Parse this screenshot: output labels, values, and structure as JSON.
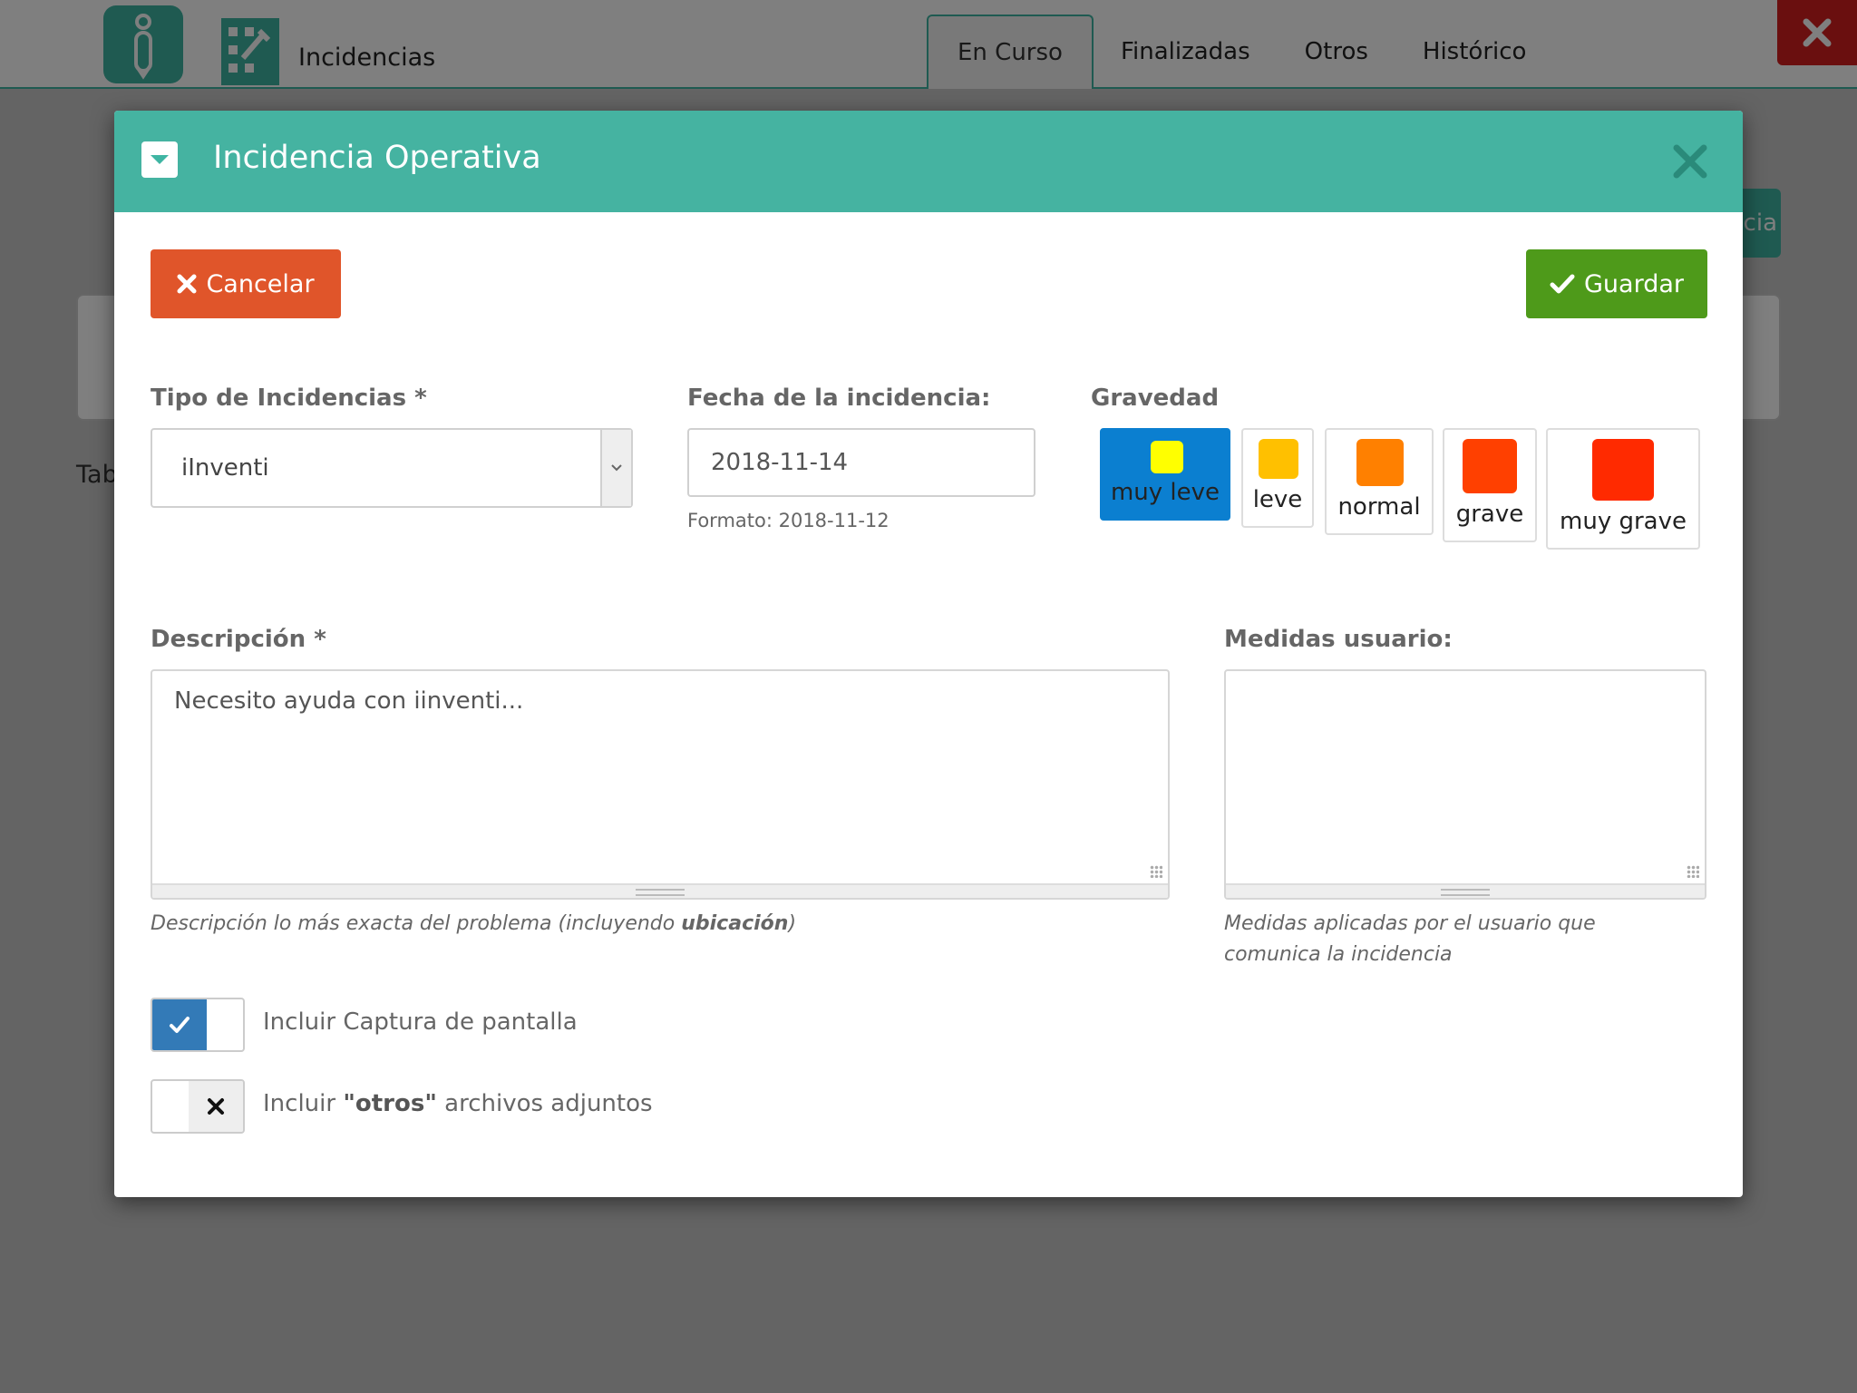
{
  "app": {
    "title": "Incidencias",
    "tabs": [
      "En Curso",
      "Finalizadas",
      "Otros",
      "Histórico"
    ],
    "background_button_text": "cia",
    "background_text": "Tab"
  },
  "modal": {
    "title": "Incidencia Operativa",
    "cancel_label": "Cancelar",
    "save_label": "Guardar",
    "tipo": {
      "label": "Tipo de Incidencias *",
      "value": "iInventi"
    },
    "fecha": {
      "label": "Fecha de la incidencia:",
      "value": "2018-11-14",
      "help": "Formato: 2018-11-12"
    },
    "gravedad": {
      "label": "Gravedad",
      "selected": "muy leve",
      "options": [
        {
          "label": "muy leve",
          "color": "#ffff00"
        },
        {
          "label": "leve",
          "color": "#ffc000"
        },
        {
          "label": "normal",
          "color": "#ff8000"
        },
        {
          "label": "grave",
          "color": "#ff4000"
        },
        {
          "label": "muy grave",
          "color": "#ff2a00"
        }
      ]
    },
    "descripcion": {
      "label": "Descripción *",
      "placeholder": "Necesito ayuda con iinventi...",
      "help_prefix": "Descripción lo más exacta del problema (incluyendo ",
      "help_bold": "ubicación",
      "help_suffix": ")"
    },
    "medidas": {
      "label": "Medidas usuario:",
      "help": "Medidas aplicadas por el usuario que comunica la incidencia"
    },
    "captura": {
      "label": "Incluir Captura de pantalla",
      "checked": true
    },
    "otros": {
      "label_prefix": "Incluir ",
      "label_bold": "\"otros\"",
      "label_suffix": " archivos adjuntos",
      "checked": false
    }
  }
}
